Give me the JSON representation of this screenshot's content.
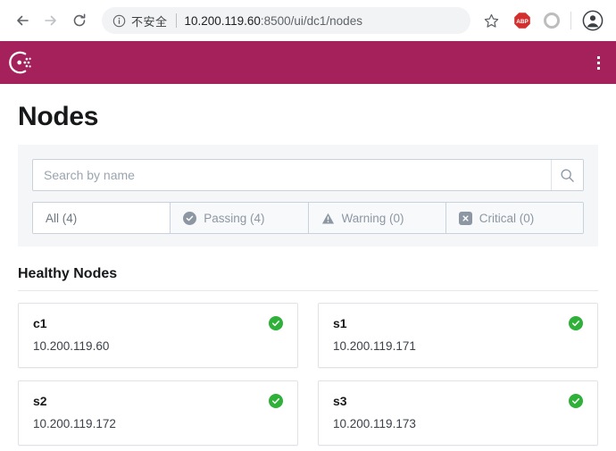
{
  "browser": {
    "back_label": "Back",
    "forward_label": "Forward",
    "reload_label": "Reload",
    "security_label": "不安全",
    "url_host": "10.200.119.60",
    "url_rest": ":8500/ui/dc1/nodes",
    "bookmark_label": "Bookmark",
    "extension_abp_label": "ABP",
    "extension_circle_label": "Extension",
    "profile_label": "Profile"
  },
  "app": {
    "brand": "Consul",
    "menu_label": "Menu"
  },
  "page": {
    "title": "Nodes"
  },
  "search": {
    "placeholder": "Search by name",
    "value": "",
    "button_label": "Search"
  },
  "tabs": [
    {
      "label": "All (4)",
      "icon": "none",
      "active": true
    },
    {
      "label": "Passing (4)",
      "icon": "check-circle",
      "active": false
    },
    {
      "label": "Warning (0)",
      "icon": "warning-triangle",
      "active": false
    },
    {
      "label": "Critical (0)",
      "icon": "x-square",
      "active": false
    }
  ],
  "section": {
    "title": "Healthy Nodes"
  },
  "nodes": [
    {
      "name": "c1",
      "address": "10.200.119.60",
      "status": "passing"
    },
    {
      "name": "s1",
      "address": "10.200.119.171",
      "status": "passing"
    },
    {
      "name": "s2",
      "address": "10.200.119.172",
      "status": "passing"
    },
    {
      "name": "s3",
      "address": "10.200.119.173",
      "status": "passing"
    }
  ],
  "colors": {
    "brand": "#a5215c",
    "passing": "#2eb039",
    "muted": "#8d97a3",
    "panel": "#f4f6f8"
  }
}
